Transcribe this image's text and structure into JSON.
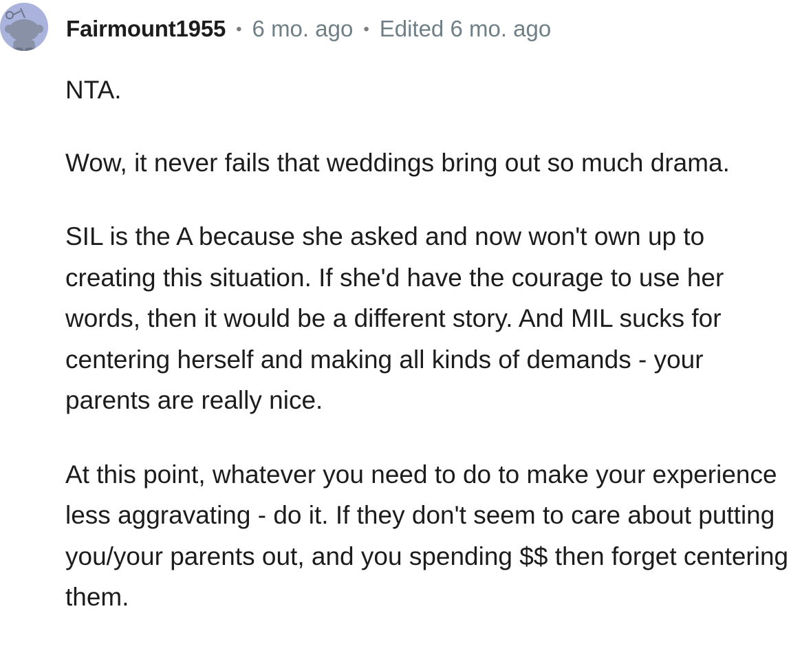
{
  "comment": {
    "author": "Fairmount1955",
    "separator": "•",
    "posted": "6 mo. ago",
    "edited": "Edited 6 mo. ago",
    "avatar_icon": "snoo-avatar-icon",
    "colors": {
      "avatar_bg": "#a9b3dc",
      "meta_text": "#6f7f86",
      "body_text": "#1c1c1c"
    },
    "paragraphs": [
      "NTA.",
      "Wow, it never fails that weddings bring out so much drama.",
      "SIL is the A because she asked and now won't own up to creating this situation. If she'd have the courage to use her words, then it would be a different story. And MIL sucks for centering herself and making all kinds of demands - your parents are really nice.",
      "At this point, whatever you need to do to make your experience less aggravating - do it. If they don't seem to care about putting you/your parents out, and you spending $$ then forget centering them."
    ]
  }
}
